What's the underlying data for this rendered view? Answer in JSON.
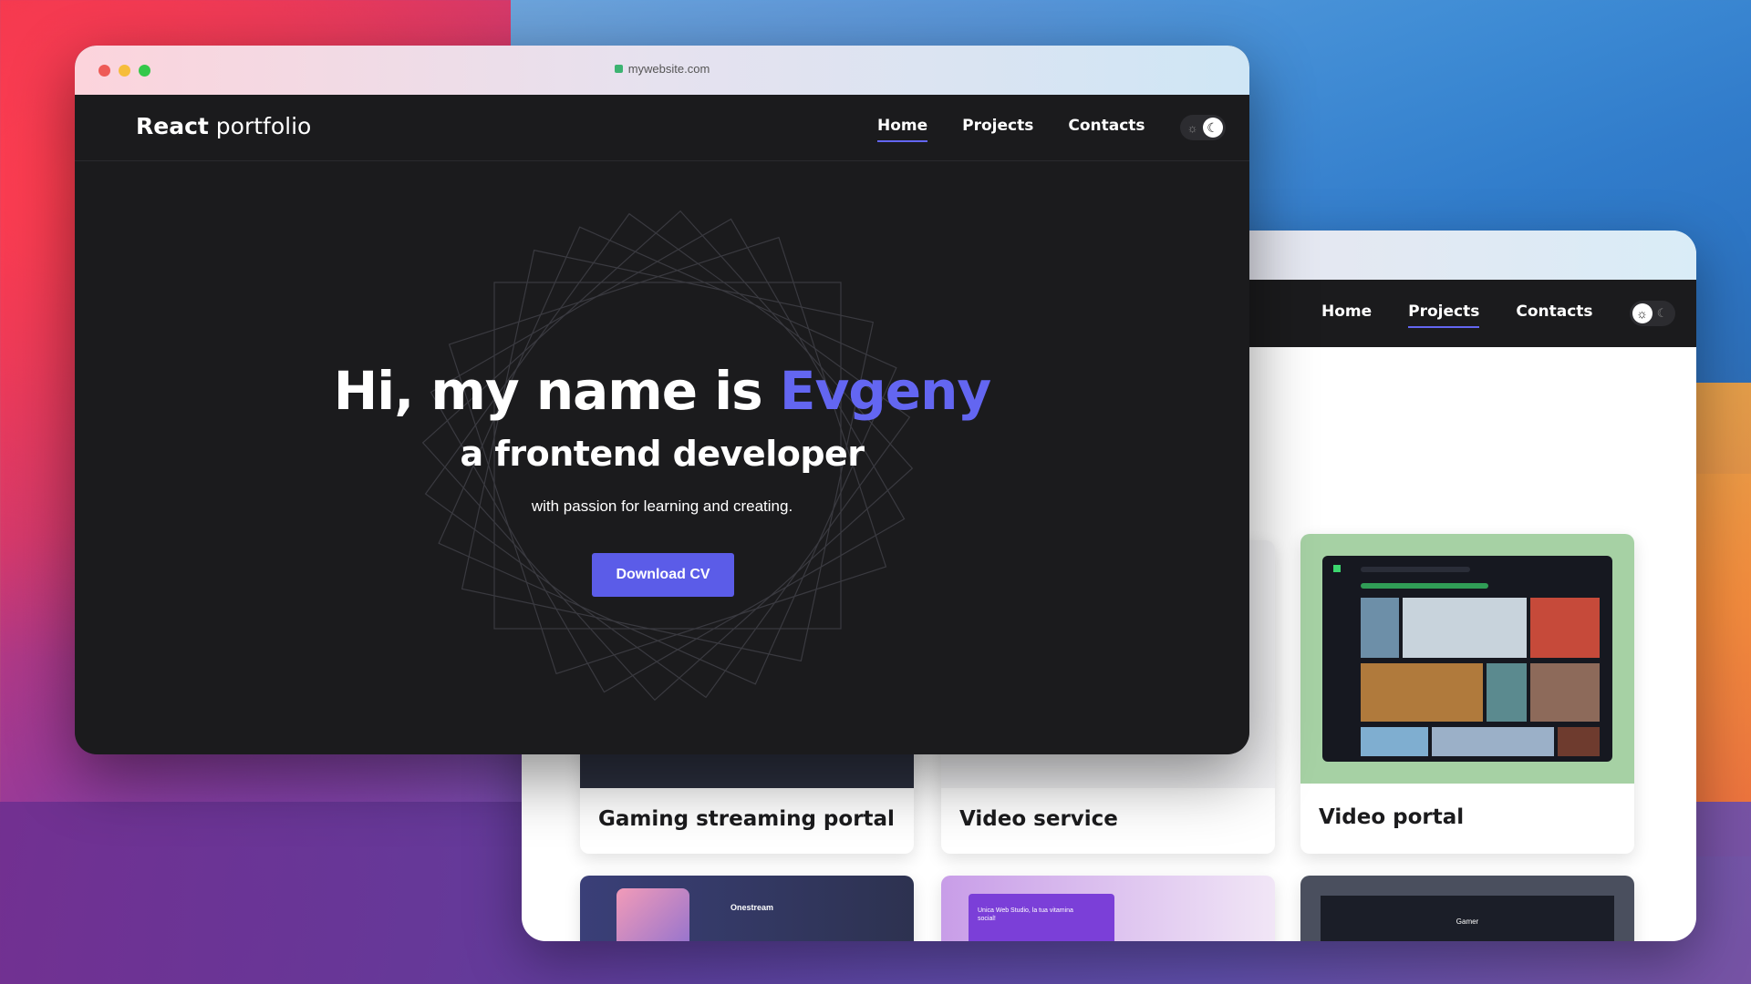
{
  "front_window": {
    "url": "mywebsite.com",
    "logo_bold": "React",
    "logo_rest": " portfolio",
    "nav": [
      "Home",
      "Projects",
      "Contacts"
    ],
    "active_nav": "Home",
    "theme_toggle": "dark",
    "hero": {
      "greeting": "Hi, my name is ",
      "name": "Evgeny",
      "role": "a frontend developer",
      "tagline": "with passion for learning and creating.",
      "button": "Download CV"
    },
    "colors": {
      "accent": "#6366f1",
      "background": "#1b1b1d"
    }
  },
  "back_window": {
    "nav": [
      "Home",
      "Projects",
      "Contacts"
    ],
    "active_nav": "Projects",
    "theme_toggle": "light",
    "projects": [
      {
        "title": "Gaming streaming portal"
      },
      {
        "title": "Video service"
      },
      {
        "title": "Video portal"
      }
    ],
    "thumb_texts": {
      "onestream": "Onestream",
      "unica": "Unica Web Studio, la tua vitamina social!",
      "gamer": "Gamer"
    }
  }
}
